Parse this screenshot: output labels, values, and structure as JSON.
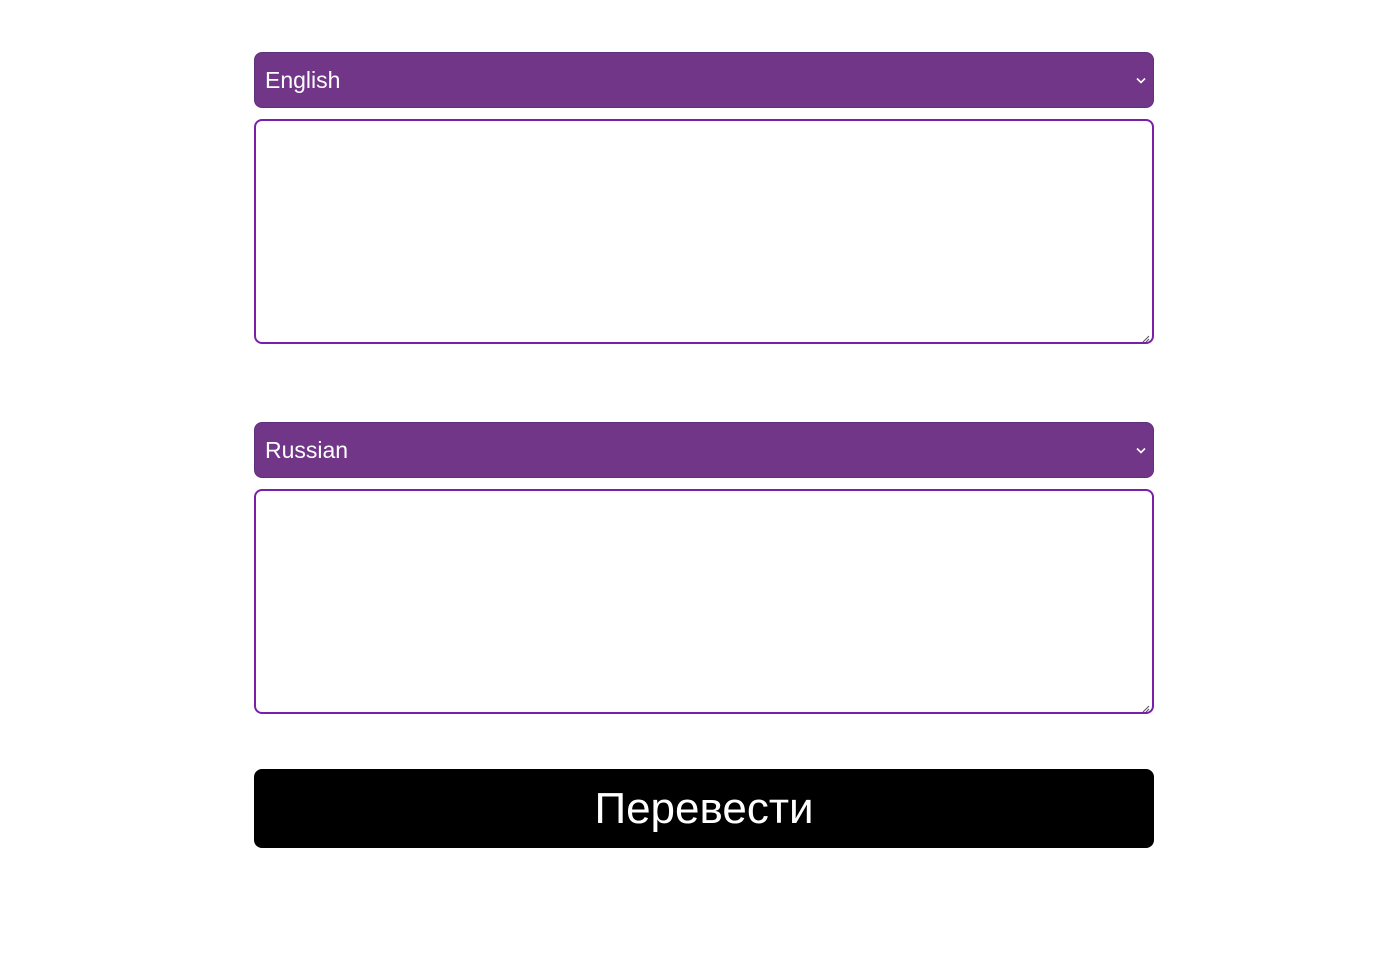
{
  "source": {
    "language": "English",
    "text": ""
  },
  "target": {
    "language": "Russian",
    "text": ""
  },
  "translate_button": {
    "label": "Перевести"
  },
  "colors": {
    "select_bg": "#713688",
    "textarea_border": "#7a1fa8",
    "button_bg": "#000000",
    "button_text": "#ffffff"
  },
  "icons": {
    "dropdown": "chevron-down-icon",
    "resize": "resize-handle-icon"
  }
}
